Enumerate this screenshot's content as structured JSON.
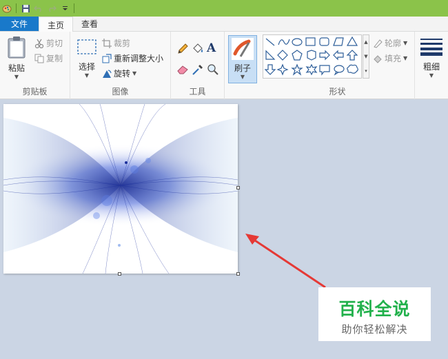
{
  "quick_access": {
    "icons": [
      "paint-app-icon",
      "save-icon",
      "undo-icon",
      "redo-icon",
      "customize-dropdown-icon"
    ]
  },
  "tabs": [
    {
      "label": "文件"
    },
    {
      "label": "主页"
    },
    {
      "label": "查看"
    }
  ],
  "ribbon": {
    "clipboard": {
      "label": "剪贴板",
      "paste": "粘贴",
      "cut": "剪切",
      "copy": "复制"
    },
    "image": {
      "label": "图像",
      "select": "选择",
      "crop": "裁剪",
      "resize": "重新调整大小",
      "rotate": "旋转"
    },
    "tools": {
      "label": "工具"
    },
    "brushes": {
      "label": "刷子"
    },
    "shapes": {
      "label": "形状",
      "outline": "轮廓",
      "fill": "填充"
    },
    "size": {
      "label": "粗细"
    }
  },
  "watermark": {
    "title": "百科全说",
    "subtitle": "助你轻松解决"
  },
  "colors": {
    "titlebar": "#8bc34a",
    "file_tab": "#1979ca",
    "workspace": "#cbd5e4",
    "arrow": "#e53935",
    "watermark_green": "#22b14c"
  }
}
